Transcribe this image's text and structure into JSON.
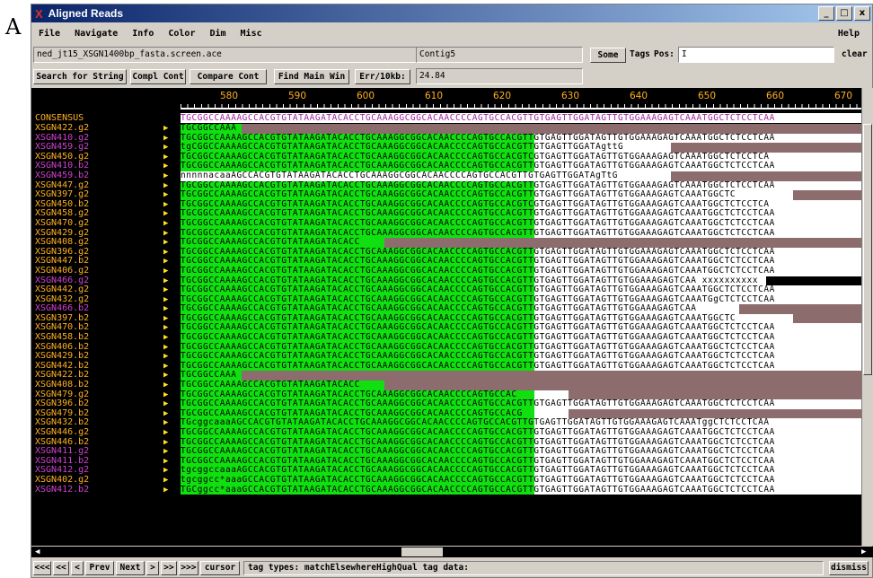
{
  "figure_label": "A",
  "window": {
    "title": "Aligned Reads",
    "minimize": "_",
    "maximize": "□",
    "close": "x"
  },
  "menu": [
    "File",
    "Navigate",
    "Info",
    "Color",
    "Dim",
    "Misc"
  ],
  "menu_help": "Help",
  "toolbar": {
    "filename": "ned_jt15_XSGN1400bp_fasta.screen.ace",
    "contig": "Contig5",
    "some_label": "Some",
    "tags_label": "Tags",
    "pos_label": "Pos:",
    "pos_value": "I",
    "clear_label": "clear",
    "search_label": "Search for String",
    "compl_label": "Compl Cont",
    "compare_label": "Compare Cont",
    "find_main_label": "Find Main Win",
    "err_label": "Err/10kb:",
    "err_value": "24.84"
  },
  "ruler_ticks": [
    "580",
    "590",
    "600",
    "610",
    "620",
    "630",
    "640",
    "650",
    "660",
    "670"
  ],
  "consensus": {
    "label": "CONSENSUS",
    "sequence": "TGCGGCCAAAAGCCACGTGTATAAGATACACCTGCAAAGGCGGCACAACCCCAGTGCCACGTTGTGAGTTGGATAGTTGTGGAAAGAGTCAAATGGCTCTCCTCAA"
  },
  "reads": [
    {
      "name": "XSGN422.g2",
      "color": "#ffb020",
      "green_end": 0.09,
      "white_end": 0.09,
      "gray_end": 1.0,
      "text": "TGCGGCCAAA"
    },
    {
      "name": "XSGN410.g2",
      "color": "#d040d0",
      "green_end": 0.52,
      "white_end": 1.0,
      "gray_end": 1.0,
      "text": "TGCGGCCAAAAGCCACGTGTATAAGATACACCTGCAAAGGCGGCACAACCCCAGTGCCACGTTGTGAGTTGGATAGTTGTGGAAAGAGTCAAATGGCTCTCCTCAA"
    },
    {
      "name": "XSGN459.g2",
      "color": "#d040d0",
      "green_end": 0.52,
      "white_end": 0.72,
      "gray_end": 1.0,
      "text": "tgCGGCCAAAAGCCACGTGTATAAGATACACCTGCAAAGGCGGCACAACCCCAGTGCCACGTTGTGAGTTGGATAgttG"
    },
    {
      "name": "XSGN450.g2",
      "color": "#ffb020",
      "green_end": 0.52,
      "white_end": 1.0,
      "gray_end": 1.0,
      "text": "TGCGGCCAAAAGCCACGTGTATAAGATACACCTGCAAAGGCGGCACAACCCCAGTGCCACGTCGTGAGTTGGATAGTTGTGGAAAGAGTCAAATGGCTCTCCTCA"
    },
    {
      "name": "XSGN410.b2",
      "color": "#d040d0",
      "green_end": 0.52,
      "white_end": 1.0,
      "gray_end": 1.0,
      "text": "TGCGGCCAAAAGCCACGTGTATAAGATACACCTGCAAAGGCGGCACAACCCCAGTGCCACGTTGTGAGTTGGATAGTTGTGGAAAGAGTCAAATGGCTCTCCTCAA"
    },
    {
      "name": "XSGN459.b2",
      "color": "#d040d0",
      "green_end": 0.0,
      "white_end": 0.72,
      "gray_end": 1.0,
      "text": "nnnnnacaaAGCCACGTGTATAAGATACACCTGCAAAGGCGGCACAACCCCAGTGCCACGTTGTGAGTTGGATAgTtG"
    },
    {
      "name": "XSGN447.g2",
      "color": "#ffb020",
      "green_end": 0.52,
      "white_end": 1.0,
      "gray_end": 1.0,
      "text": "TGCGGCCAAAAGCCACGTGTATAAGATACACCTGCAAAGGCGGCACAACCCCAGTGCCACGTTGTGAGTTGGATAGTTGTGGAAAGAGTCAAATGGCTCTCCTCAA"
    },
    {
      "name": "XSGN397.g2",
      "color": "#ffb020",
      "green_end": 0.52,
      "white_end": 0.9,
      "gray_end": 1.0,
      "text": "TGCGGCCAAAAGCCACGTGTATAAGATACACCTGCAAAGGCGGCACAACCCCAGTGCCACGTTGTGAGTTGGATAGTTGTGGAAAGAGTCAAATGGCTC"
    },
    {
      "name": "XSGN450.b2",
      "color": "#ffb020",
      "green_end": 0.52,
      "white_end": 1.0,
      "gray_end": 1.0,
      "text": "TGCGGCCAAAAGCCACGTGTATAAGATACACCTGCAAAGGCGGCACAACCCCAGTGCCACGTCGTGAGTTGGATAGTTGTGGAAAGAGTCAAATGGCTCTCCTCA"
    },
    {
      "name": "XSGN458.g2",
      "color": "#ffb020",
      "green_end": 0.52,
      "white_end": 1.0,
      "gray_end": 1.0,
      "text": "TGCGGCCAAAAGCCACGTGTATAAGATACACCTGCAAAGGCGGCACAACCCCAGTGCCACGTTGTGAGTTGGATAGTTGTGGAAAGAGTCAAATGGCTCTCCTCAA"
    },
    {
      "name": "XSGN470.g2",
      "color": "#ffb020",
      "green_end": 0.52,
      "white_end": 1.0,
      "gray_end": 1.0,
      "text": "TGCGGCCAAAAGCCACGTGTATAAGATACACCTGCAAAGGCGGCACAACCCCAGTGCCACGTTGTGAGTTGGATAGTTGTGGAAAGAGTCAAATGGCTCTCCTCAA"
    },
    {
      "name": "XSGN429.g2",
      "color": "#ffb020",
      "green_end": 0.52,
      "white_end": 1.0,
      "gray_end": 1.0,
      "text": "TGCGGCCAAAAGCCACGTGTATAAGATACACCTGCAAAGGCGGCACAACCCCAGTGCCACGTTGTGAGTTGGATAGTTGTGGAAAGAGTCAAATGGCTCTCCTCAA"
    },
    {
      "name": "XSGN408.g2",
      "color": "#ffb020",
      "green_end": 0.3,
      "white_end": 0.3,
      "gray_end": 1.0,
      "text": "TGCGGCCAAAAGCCACGTGTATAAGATACACC"
    },
    {
      "name": "XSGN396.g2",
      "color": "#ffb020",
      "green_end": 0.52,
      "white_end": 1.0,
      "gray_end": 1.0,
      "text": "TGCGGCCAAAAGCCACGTGTATAAGATACACCTGCAAAGGCGGCACAACCCCAGTGCCACGTTGTGAGTTGGATAGTTGTGGAAAGAGTCAAATGGCTCTCCTCAA"
    },
    {
      "name": "XSGN447.b2",
      "color": "#ffb020",
      "green_end": 0.52,
      "white_end": 1.0,
      "gray_end": 1.0,
      "text": "TGCGGCCAAAAGCCACGTGTATAAGATACACCTGCAAAGGCGGCACAACCCCAGTGCCACGTTGTGAGTTGGATAGTTGTGGAAAGAGTCAAATGGCTCTCCTCAA"
    },
    {
      "name": "XSGN406.g2",
      "color": "#ffb020",
      "green_end": 0.52,
      "white_end": 1.0,
      "gray_end": 1.0,
      "text": "TGCGGCCAAAAGCCACGTGTATAAGATACACCTGCAAAGGCGGCACAACCCCAGTGCCACGTTGTGAGTTGGATAGTTGTGGAAAGAGTCAAATGGCTCTCCTCAA"
    },
    {
      "name": "XSGN466.g2",
      "color": "#d040d0",
      "green_end": 0.52,
      "white_end": 0.86,
      "gray_end": 0.86,
      "text": "TGCGGCCAAAAGCCACGTGTATAAGATACACCTGCAAAGGCGGCACAACCCCAGTGCCACGTTGTGAGTTGGATAGTTGTGGAAAGAGTCAA  xxxxxxxxxx"
    },
    {
      "name": "XSGN442.g2",
      "color": "#ffb020",
      "green_end": 0.52,
      "white_end": 1.0,
      "gray_end": 1.0,
      "text": "TGCGGCCAAAAGCCACGTGTATAAGATACACCTGCAAAGGCGGCACAACCCCAGTGCCACGTTGTGAGTTGGATAGTTGTGGAAAGAGTCAAATGGCTCTCCTCAA"
    },
    {
      "name": "XSGN432.g2",
      "color": "#ffb020",
      "green_end": 0.52,
      "white_end": 1.0,
      "gray_end": 1.0,
      "text": "TGCGGCCAAAAGCCACGTGTATAAGATACACCTGCAAAGGCGGCACAACCCCAGTGCCACGTTGTGAGTTGGATAGTTGTGGAAAGAGTCAAATGgCTCTCCTCAA"
    },
    {
      "name": "XSGN466.b2",
      "color": "#d040d0",
      "green_end": 0.52,
      "white_end": 0.82,
      "gray_end": 1.0,
      "text": "TGCGGCCAAAAGCCACGTGTATAAGATACACCTGCAAAGGCGGCACAACCCCAGTGCCACGTTGTGAGTTGGATAGTTGTGGAAAGAGTCAA"
    },
    {
      "name": "XSGN397.b2",
      "color": "#ffb020",
      "green_end": 0.52,
      "white_end": 0.9,
      "gray_end": 1.0,
      "text": "TGCGGCCAAAAGCCACGTGTATAAGATACACCTGCAAAGGCGGCACAACCCCAGTGCCACGTTGTGAGTTGGATAGTTGTGGAAAGAGTCAAATGGCTC"
    },
    {
      "name": "XSGN470.b2",
      "color": "#ffb020",
      "green_end": 0.52,
      "white_end": 1.0,
      "gray_end": 1.0,
      "text": "TGCGGCCAAAAGCCACGTGTATAAGATACACCTGCAAAGGCGGCACAACCCCAGTGCCACGTTGTGAGTTGGATAGTTGTGGAAAGAGTCAAATGGCTCTCCTCAA"
    },
    {
      "name": "XSGN458.b2",
      "color": "#ffb020",
      "green_end": 0.52,
      "white_end": 1.0,
      "gray_end": 1.0,
      "text": "TGCGGCCAAAAGCCACGTGTATAAGATACACCTGCAAAGGCGGCACAACCCCAGTGCCACGTTGTGAGTTGGATAGTTGTGGAAAGAGTCAAATGGCTCTCCTCAA"
    },
    {
      "name": "XSGN406.b2",
      "color": "#ffb020",
      "green_end": 0.52,
      "white_end": 1.0,
      "gray_end": 1.0,
      "text": "TGCGGCCAAAAGCCACGTGTATAAGATACACCTGCAAAGGCGGCACAACCCCAGTGCCACGTTGTGAGTTGGATAGTTGTGGAAAGAGTCAAATGGCTCTCCTCAA"
    },
    {
      "name": "XSGN429.b2",
      "color": "#ffb020",
      "green_end": 0.52,
      "white_end": 1.0,
      "gray_end": 1.0,
      "text": "TGCGGCCAAAAGCCACGTGTATAAGATACACCTGCAAAGGCGGCACAACCCCAGTGCCACGTTGTGAGTTGGATAGTTGTGGAAAGAGTCAAATGGCTCTCCTCAA"
    },
    {
      "name": "XSGN442.b2",
      "color": "#ffb020",
      "green_end": 0.52,
      "white_end": 1.0,
      "gray_end": 1.0,
      "text": "TGCGGCCAAAAGCCACGTGTATAAGATACACCTGCAAAGGCGGCACAACCCCAGTGCCACGTTGTGAGTTGGATAGTTGTGGAAAGAGTCAAATGGCTCTCCTCAA"
    },
    {
      "name": "XSGN422.b2",
      "color": "#ffb020",
      "green_end": 0.09,
      "white_end": 0.09,
      "gray_end": 1.0,
      "text": "TGCGGCCAAA"
    },
    {
      "name": "XSGN408.b2",
      "color": "#ffb020",
      "green_end": 0.3,
      "white_end": 0.3,
      "gray_end": 1.0,
      "text": "TGCGGCCAAAAGCCACGTGTATAAGATACACC"
    },
    {
      "name": "XSGN479.g2",
      "color": "#ffb020",
      "green_end": 0.52,
      "white_end": 0.57,
      "gray_end": 1.0,
      "text": "TGCGGCCAAAAGCCACGTGTATAAGATACACCTGCAAAGGCGGCACAACCCCAGTGCCAC"
    },
    {
      "name": "XSGN396.b2",
      "color": "#ffb020",
      "green_end": 0.52,
      "white_end": 1.0,
      "gray_end": 1.0,
      "text": "TGCGGCCAAAAGCCACGTGTATAAGATACACCTGCAAAGGCGGCACAACCCCAGTGCCACGTTGTGAGTTGGATAGTTGTGGAAAGAGTCAAATGGCTCTCCTCAA"
    },
    {
      "name": "XSGN479.b2",
      "color": "#ffb020",
      "green_end": 0.52,
      "white_end": 0.57,
      "gray_end": 1.0,
      "text": "TGCGGCCAAAAGCCACGTGTATAAGATACACCTGCAAAGGCGGCACAACCCCAGTGCCACG"
    },
    {
      "name": "XSGN432.b2",
      "color": "#ffb020",
      "green_end": 0.52,
      "white_end": 1.0,
      "gray_end": 1.0,
      "text": "TGcggcaaaAGCCACGTGTATAAGATACACCTGCAAAGGCGGCACAACCCCAGTGCCACGTTGTGAGTTGGATAGTTGTGGAAAGAGTCAAATggCTCTCCTCAA"
    },
    {
      "name": "XSGN446.g2",
      "color": "#ffb020",
      "green_end": 0.52,
      "white_end": 1.0,
      "gray_end": 1.0,
      "text": "TGCGGCCAAAAGCCACGTGTATAAGATACACCTGCAAAGGCGGCACAACCCCAGTGCCACGTTGTGAGTTGGATAGTTGTGGAAAGAGTCAAATGGCTCTCCTCAA"
    },
    {
      "name": "XSGN446.b2",
      "color": "#ffb020",
      "green_end": 0.52,
      "white_end": 1.0,
      "gray_end": 1.0,
      "text": "TGCGGCCAAAAGCCACGTGTATAAGATACACCTGCAAAGGCGGCACAACCCCAGTGCCACGTTGTGAGTTGGATAGTTGTGGAAAGAGTCAAATGGCTCTCCTCAA"
    },
    {
      "name": "XSGN411.g2",
      "color": "#d040d0",
      "green_end": 0.52,
      "white_end": 1.0,
      "gray_end": 1.0,
      "text": "TGCGGCCAAAAGCCACGTGTATAAGATACACCTGCAAAGGCGGCACAACCCCAGTGCCACGTTGTGAGTTGGATAGTTGTGGAAAGAGTCAAATGGCTCTCCTCAA"
    },
    {
      "name": "XSGN411.b2",
      "color": "#d040d0",
      "green_end": 0.52,
      "white_end": 1.0,
      "gray_end": 1.0,
      "text": "TGCGGCCAAAAGCCACGTGTATAAGATACACCTGCAAAGGCGGCACAACCCCAGTGCCACGTTGTGAGTTGGATAGTTGTGGAAAGAGTCAAATGGCTCTCCTCAA"
    },
    {
      "name": "XSGN412.g2",
      "color": "#d040d0",
      "green_end": 0.52,
      "white_end": 1.0,
      "gray_end": 1.0,
      "text": "tgcggccaaaAGCCACGTGTATAAGATACACCTGCAAAGGCGGCACAACCCCAGTGCCACGTTGTGAGTTGGATAGTTGTGGAAAGAGTCAAATGGCTCTCCTCAA"
    },
    {
      "name": "XSGN402.g2",
      "color": "#ffb020",
      "green_end": 0.52,
      "white_end": 1.0,
      "gray_end": 1.0,
      "text": "tgcggcc*aaaGCCACGTGTATAAGATACACCTGCAAAGGCGGCACAACCCCAGTGCCACGTTGTGAGTTGGATAGTTGTGGAAAGAGTCAAATGGCTCTCCTCAA"
    },
    {
      "name": "XSGN412.b2",
      "color": "#d040d0",
      "green_end": 0.52,
      "white_end": 1.0,
      "gray_end": 1.0,
      "text": "TGCggcc*aaaGCCACGTGTATAAGATACACCTGCAAAGGCGGCACAACCCCAGTGCCACGTTGTGAGTTGGATAGTTGTGGAAAGAGTCAAATGGCTCTCCTCAA"
    }
  ],
  "bottom": {
    "nav": [
      "<<<",
      "<<",
      "<",
      "Prev",
      "Next",
      ">",
      ">>",
      ">>>",
      "cursor"
    ],
    "status": "tag types: matchElsewhereHighQual tag data:",
    "dismiss": "dismiss"
  },
  "colors": {
    "title_bg": "#0a246a",
    "high_quality": "#10e010",
    "low_quality_region": "#8c6c6c",
    "even_read_name": "#ffb020",
    "odd_read_name": "#d040d0",
    "ruler_text": "#ffb020"
  }
}
